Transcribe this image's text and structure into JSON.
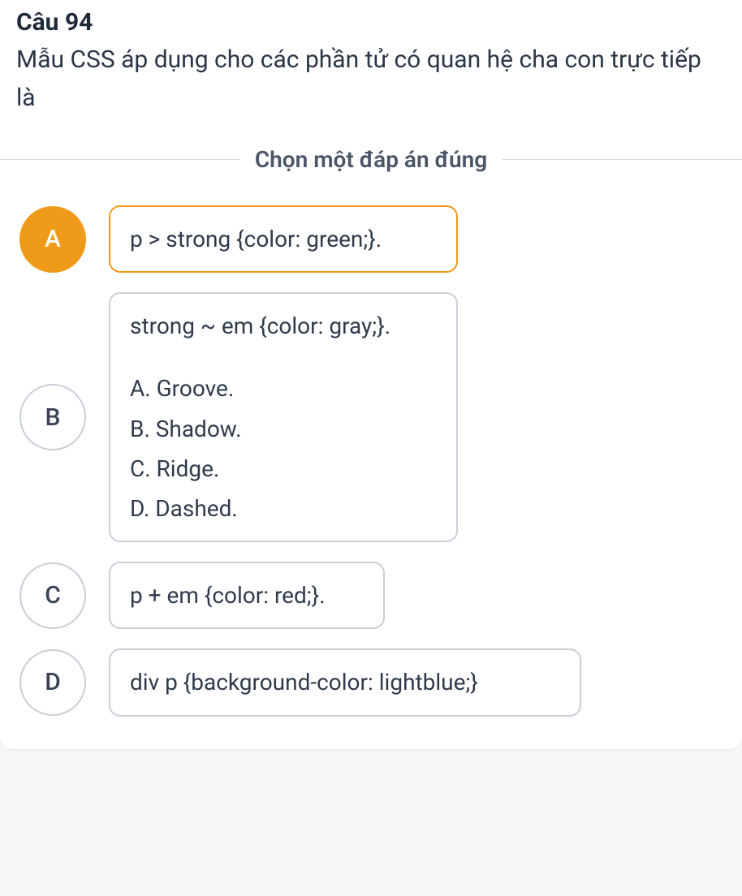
{
  "question": {
    "title": "Câu 94",
    "text": "Mẫu CSS áp dụng cho các phần tử có quan hệ cha con trực tiếp là"
  },
  "instruction": "Chọn một đáp án đúng",
  "options": {
    "a": {
      "letter": "A",
      "text": "p > strong {color: green;}."
    },
    "b": {
      "letter": "B",
      "line1": "strong  ~  em {color: gray;}.",
      "sub1": "A. Groove.",
      "sub2": "B. Shadow.",
      "sub3": "C. Ridge.",
      "sub4": "D. Dashed."
    },
    "c": {
      "letter": "C",
      "text": "p + em {color: red;}."
    },
    "d": {
      "letter": "D",
      "text": "div p {background-color: lightblue;}"
    }
  }
}
